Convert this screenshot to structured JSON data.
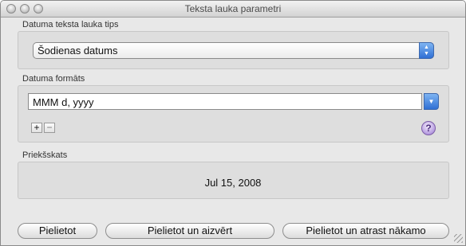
{
  "window": {
    "title": "Teksta lauka parametri"
  },
  "date_type": {
    "section_label": "Datuma teksta lauka tips",
    "selected_value": "Šodienas datums"
  },
  "date_format": {
    "section_label": "Datuma formāts",
    "value": "MMM d, yyyy",
    "add_symbol": "+",
    "remove_symbol": "−",
    "help_symbol": "?"
  },
  "preview": {
    "section_label": "Priekšskats",
    "value": "Jul 15, 2008"
  },
  "buttons": {
    "apply": "Pielietot",
    "apply_close": "Pielietot un aizvērt",
    "apply_find_next": "Pielietot un atrast nākamo"
  },
  "icons": {
    "popup_arrows": "up-down-chevron-icon",
    "combo_arrow": "chevron-down-icon",
    "help": "question-mark-icon",
    "resize": "resize-grip-icon"
  }
}
